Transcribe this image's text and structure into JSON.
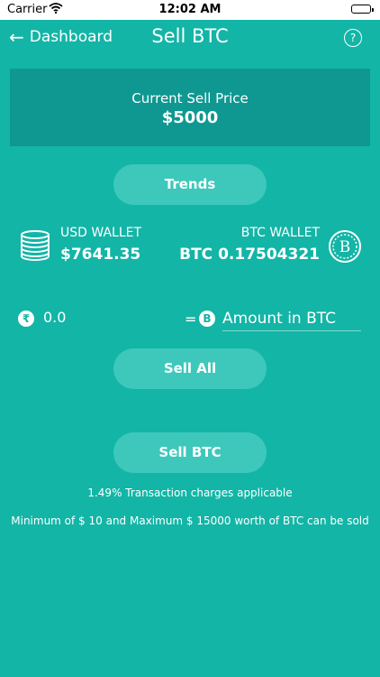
{
  "status_bar": {
    "carrier": "Carrier",
    "time": "12:02 AM"
  },
  "nav": {
    "back_label": "Dashboard",
    "title": "Sell BTC",
    "help_label": "?"
  },
  "price_card": {
    "label": "Current Sell Price",
    "value": "$5000"
  },
  "buttons": {
    "trends": "Trends",
    "sell_all": "Sell All",
    "sell_btc": "Sell BTC"
  },
  "usd_wallet": {
    "label": "USD WALLET",
    "value": "$7641.35"
  },
  "btc_wallet": {
    "label": "BTC WALLET",
    "value": "BTC 0.17504321"
  },
  "converter": {
    "currency_symbol": "₹",
    "fiat_value": "0.0",
    "equals": "=",
    "btc_symbol": "B",
    "btc_placeholder": "Amount in BTC"
  },
  "notes": {
    "charges": "1.49% Transaction charges applicable",
    "limits": "Minimum of $ 10 and Maximum $ 15000 worth of BTC can be sold"
  },
  "colors": {
    "background": "#13b5a6",
    "card": "#0e9891",
    "button": "#3dc8bb"
  },
  "icons": {
    "back": "arrow-left-icon",
    "help": "question-circle-icon",
    "usd_wallet": "coin-stack-icon",
    "btc_wallet": "bitcoin-coin-icon",
    "rupee": "rupee-icon",
    "bitcoin": "bitcoin-icon"
  }
}
